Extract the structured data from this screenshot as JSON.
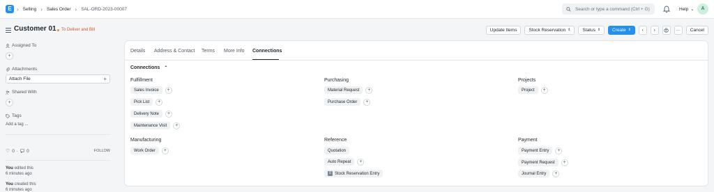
{
  "navbar": {
    "logo": "E",
    "breadcrumbs": [
      "Selling",
      "Sales Order",
      "SAL-ORD-2023-00007"
    ],
    "search_placeholder": "Search or type a command (Ctrl + G)",
    "help": "Help",
    "avatar": "A"
  },
  "page": {
    "title": "Customer 01",
    "status": "To Deliver and Bill",
    "status_color": "#f5833b",
    "actions": {
      "update_items": "Update Items",
      "stock_reservation": "Stock Reservation",
      "status": "Status",
      "create": "Create",
      "cancel": "Cancel"
    }
  },
  "sidebar": {
    "assigned_to": "Assigned To",
    "attachments": "Attachments",
    "attach_file": "Attach File",
    "shared_with": "Shared With",
    "tags": "Tags",
    "add_tag": "Add a tag ...",
    "likes": "0",
    "comments": "0",
    "follow": "FOLLOW",
    "activity": [
      {
        "who": "You",
        "what": "edited this",
        "when": "6 minutes ago"
      },
      {
        "who": "You",
        "what": "created this",
        "when": "6 minutes ago"
      }
    ]
  },
  "tabs": [
    "Details",
    "Address & Contact",
    "Terms",
    "More Info",
    "Connections"
  ],
  "active_tab": "Connections",
  "connections": {
    "title": "Connections",
    "groups": {
      "fulfillment": {
        "title": "Fulfillment",
        "items": [
          "Sales Invoice",
          "Pick List",
          "Delivery Note",
          "Maintenance Visit"
        ]
      },
      "purchasing": {
        "title": "Purchasing",
        "items": [
          "Material Request",
          "Purchase Order"
        ]
      },
      "projects": {
        "title": "Projects",
        "items": [
          "Project"
        ]
      },
      "manufacturing": {
        "title": "Manufacturing",
        "items": [
          "Work Order"
        ]
      },
      "reference": {
        "title": "Reference",
        "items": [
          "Quotation",
          "Auto Repeat",
          "Stock Reservation Entry"
        ],
        "badge": "0"
      },
      "payment": {
        "title": "Payment",
        "items": [
          "Payment Entry",
          "Payment Request",
          "Journal Entry"
        ]
      }
    }
  },
  "colors": {
    "primary": "#2490ef",
    "indicator": "#cb5a2a"
  }
}
